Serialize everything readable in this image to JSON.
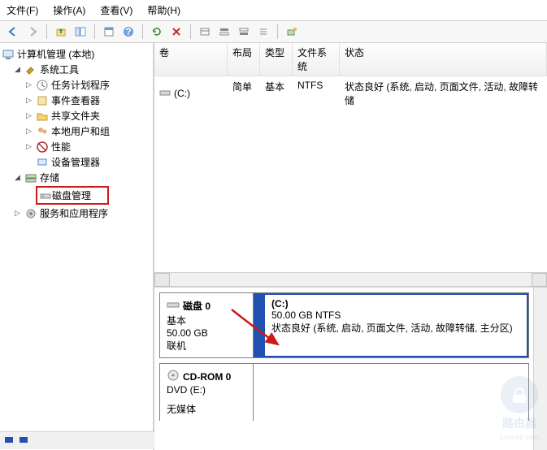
{
  "menu": {
    "file": "文件(F)",
    "action": "操作(A)",
    "view": "查看(V)",
    "help": "帮助(H)"
  },
  "tree": {
    "root": "计算机管理 (本地)",
    "systools": "系统工具",
    "t0": "任务计划程序",
    "t1": "事件查看器",
    "t2": "共享文件夹",
    "t3": "本地用户和组",
    "t4": "性能",
    "t5": "设备管理器",
    "storage": "存储",
    "diskmgmt": "磁盘管理",
    "services": "服务和应用程序"
  },
  "cols": {
    "vol": "卷",
    "layout": "布局",
    "type": "类型",
    "fs": "文件系统",
    "status": "状态"
  },
  "row": {
    "vol": "(C:)",
    "layout": "简单",
    "type": "基本",
    "fs": "NTFS",
    "status": "状态良好 (系统, 启动, 页面文件, 活动, 故障转储"
  },
  "disk0": {
    "title": "磁盘 0",
    "kind": "基本",
    "size": "50.00 GB",
    "state": "联机",
    "part_title": "(C:)",
    "part_size": "50.00 GB NTFS",
    "part_status": "状态良好 (系统, 启动, 页面文件, 活动, 故障转储, 主分区)"
  },
  "cdrom": {
    "title": "CD-ROM 0",
    "kind": "DVD (E:)",
    "state": "无媒体"
  },
  "watermark": {
    "label": "路由器",
    "url": "luyouqi.com"
  }
}
